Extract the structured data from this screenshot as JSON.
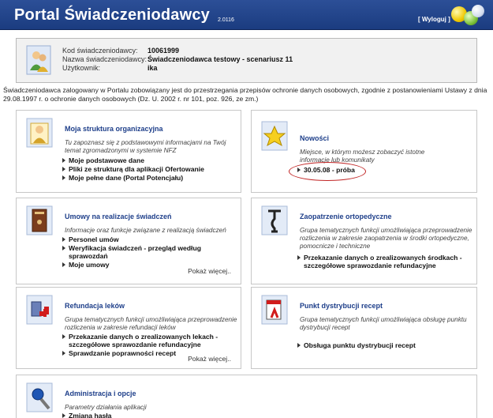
{
  "header": {
    "title": "Portal Świadczeniodawcy",
    "version": "2.0116",
    "logout_label": "[ Wyloguj ]"
  },
  "info": {
    "rows": [
      {
        "label": "Kod świadczeniodawcy:",
        "value": "10061999"
      },
      {
        "label": "Nazwa świadczeniodawcy:",
        "value": "Świadczeniodawca testowy - scenariusz 11"
      },
      {
        "label": "Użytkownik:",
        "value": "ika"
      }
    ]
  },
  "notice": "Świadczeniodawca zalogowany w Portalu zobowiązany jest do przestrzegania przepisów ochronie danych osobowych, zgodnie z postanowieniami Ustawy z dnia 29.08.1997 r. o ochronie danych osobowych (Dz. U. 2002 r. nr 101, poz. 926, ze zm.)",
  "cards": {
    "struktura": {
      "title": "Moja struktura organizacyjna",
      "desc": [
        "Tu zapoznasz się z podstawowymi informacjami na Twój",
        "temat zgromadzonymi w systemie NFZ"
      ],
      "items": [
        "Moje podstawowe dane",
        "Pliki ze strukturą dla aplikacji Ofertowanie",
        "Moje pełne dane (Portal Potencjału)"
      ]
    },
    "nowosci": {
      "title": "Nowości",
      "desc": [
        "Miejsce, w którym możesz zobaczyć istotne",
        "informacje lub komunikaty"
      ],
      "items": [
        "30.05.08 - próba"
      ]
    },
    "umowy": {
      "title": "Umowy na realizacje świadczeń",
      "desc": [
        "Informacje oraz funkcje związane z realizacją świadczeń"
      ],
      "items": [
        "Personel umów",
        "Weryfikacja świadczeń - przegląd według",
        "sprawozdań",
        "Moje umowy"
      ],
      "more": "Pokaż więcej.."
    },
    "zaopatrzenie": {
      "title": "Zaopatrzenie ortopedyczne",
      "desc": [
        "Grupa tematycznych funkcji umożliwiająca przeprowadzenie",
        "rozliczenia w zakresie zaopatrzenia w środki ortopedyczne,",
        "pomocnicze i techniczne"
      ],
      "items": [
        "Przekazanie danych o zrealizowanych środkach -",
        "szczegółowe sprawozdanie refundacyjne"
      ]
    },
    "refundacja": {
      "title": "Refundacja leków",
      "desc": [
        "Grupa tematycznych funkcji umożliwiająca przeprowadzenie",
        "rozliczenia w zakresie refundacji leków"
      ],
      "items": [
        "Przekazanie danych o zrealizowanych lekach -",
        "szczegółowe sprawozdanie refundacyjne",
        "Sprawdzanie poprawności recept"
      ],
      "more": "Pokaż więcej.."
    },
    "punkt": {
      "title": "Punkt dystrybucji recept",
      "desc": [
        "Grupa tematycznych funkcji umożliwiająca obsługę punktu",
        "dystrybucji recept"
      ],
      "items": [
        "Obsługa punktu dystrybucji recept"
      ]
    },
    "admin": {
      "title": "Administracja i opcje",
      "desc": [
        "Parametry działania aplikacji"
      ],
      "items": [
        "Zmiana hasła"
      ]
    }
  }
}
